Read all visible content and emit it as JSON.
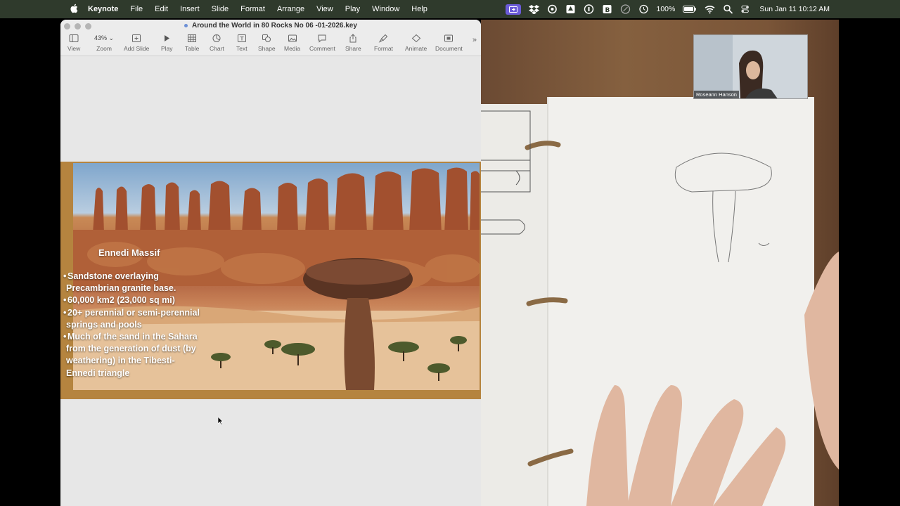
{
  "menubar": {
    "app": "Keynote",
    "menus": [
      "File",
      "Edit",
      "Insert",
      "Slide",
      "Format",
      "Arrange",
      "View",
      "Play",
      "Window",
      "Help"
    ],
    "battery": "100%",
    "datetime": "Sun Jan 11  10:12 AM"
  },
  "window": {
    "title": "Around the World in 80 Rocks No 06 -01-2026.key"
  },
  "toolbar": {
    "zoom_value": "43%",
    "items": [
      {
        "label": "View",
        "icon": "sidebar-icon"
      },
      {
        "label": "Zoom",
        "icon": "zoom-menu"
      },
      {
        "label": "Add Slide",
        "icon": "plus-square-icon"
      },
      {
        "label": "Play",
        "icon": "play-icon"
      },
      {
        "label": "Table",
        "icon": "table-icon"
      },
      {
        "label": "Chart",
        "icon": "chart-icon"
      },
      {
        "label": "Text",
        "icon": "text-icon"
      },
      {
        "label": "Shape",
        "icon": "shape-icon"
      },
      {
        "label": "Media",
        "icon": "media-icon"
      },
      {
        "label": "Comment",
        "icon": "comment-icon"
      },
      {
        "label": "Share",
        "icon": "share-icon"
      },
      {
        "label": "Format",
        "icon": "paintbrush-icon"
      },
      {
        "label": "Animate",
        "icon": "diamond-icon"
      },
      {
        "label": "Document",
        "icon": "document-icon"
      }
    ]
  },
  "slide": {
    "title": "Ennedi Massif",
    "bullets": [
      "Sandstone overlaying Precambrian granite base.",
      "60,000 km2 (23,000 sq mi)",
      "20+ perennial or semi-perennial springs and pools",
      "Much of the sand in the Sahara from the generation of dust (by weathering) in the Tibesti-Ennedi triangle"
    ]
  },
  "video": {
    "participant_name": "Roseann Hanson"
  }
}
